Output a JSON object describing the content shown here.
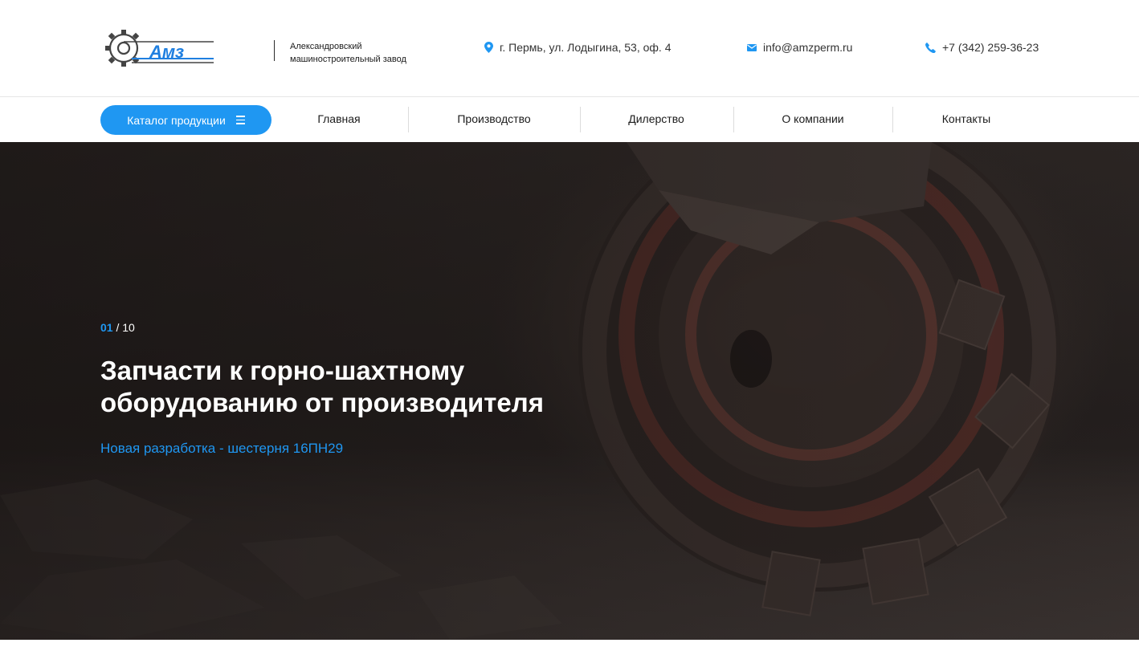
{
  "header": {
    "logo_text": "Амз",
    "company_name_line1": "Александровский",
    "company_name_line2": "машиностроительный завод",
    "address": "г. Пермь, ул. Лодыгина, 53, оф. 4",
    "email": "info@amzperm.ru",
    "phone": "+7 (342) 259-36-23"
  },
  "nav": {
    "catalog_label": "Каталог продукции",
    "items": [
      {
        "label": "Главная"
      },
      {
        "label": "Производство"
      },
      {
        "label": "Дилерство"
      },
      {
        "label": "О компании"
      },
      {
        "label": "Контакты"
      }
    ]
  },
  "hero": {
    "slide_current": "01",
    "slide_total": "/ 10",
    "title": "Запчасти к горно-шахтному оборудованию от производителя",
    "link": "Новая разработка - шестерня 16ПН29"
  },
  "colors": {
    "accent": "#1f97f2",
    "hero_bg": "#2c2624",
    "text": "#1b1b1b"
  },
  "icons": {
    "address": "location-pin-icon",
    "email": "envelope-icon",
    "phone": "phone-icon",
    "catalog": "menu-icon"
  }
}
